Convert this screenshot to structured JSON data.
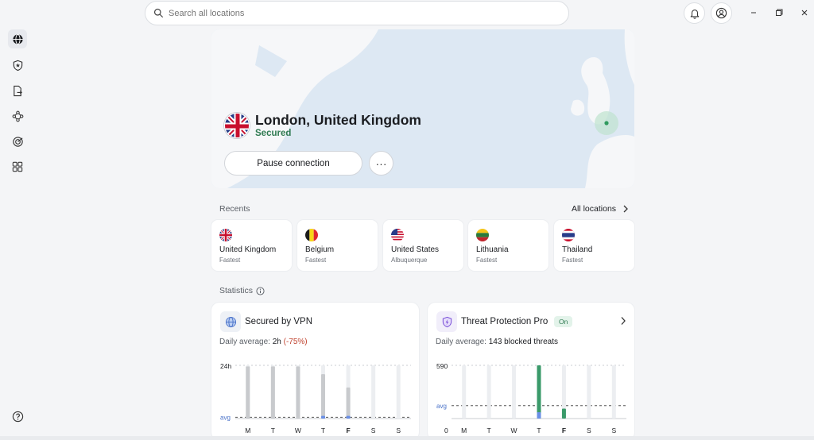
{
  "search": {
    "placeholder": "Search all locations"
  },
  "sidebar": {
    "items": [
      {
        "icon": "globe-icon",
        "active": true
      },
      {
        "icon": "shield-icon",
        "active": false
      },
      {
        "icon": "file-transfer-icon",
        "active": false
      },
      {
        "icon": "meshnet-icon",
        "active": false
      },
      {
        "icon": "target-icon",
        "active": false
      },
      {
        "icon": "apps-grid-icon",
        "active": false
      }
    ],
    "help_icon": "help-icon"
  },
  "connection": {
    "location": "London, United Kingdom",
    "status": "Secured",
    "pause_label": "Pause connection",
    "more_label": "···",
    "status_color": "#2f7a51"
  },
  "recents": {
    "label": "Recents",
    "all_label": "All locations",
    "items": [
      {
        "name": "United Kingdom",
        "sub": "Fastest",
        "flag": "uk"
      },
      {
        "name": "Belgium",
        "sub": "Fastest",
        "flag": "be"
      },
      {
        "name": "United States",
        "sub": "Albuquerque",
        "flag": "us"
      },
      {
        "name": "Lithuania",
        "sub": "Fastest",
        "flag": "lt"
      },
      {
        "name": "Thailand",
        "sub": "Fastest",
        "flag": "th"
      }
    ]
  },
  "statistics": {
    "label": "Statistics",
    "vpn": {
      "title": "Secured by VPN",
      "sub_label": "Daily average:",
      "sub_value": "2h",
      "sub_change": "(-75%)",
      "chart_data": {
        "type": "bar",
        "categories": [
          "M",
          "T",
          "W",
          "T",
          "F",
          "S",
          "S"
        ],
        "highlight_category": 4,
        "ytick_top": "24h",
        "avg_label": "avg",
        "ylim": [
          0,
          24
        ],
        "avg_value": 0.6,
        "series": [
          {
            "values": [
              24,
              24,
              24,
              24,
              24,
              24,
              24
            ],
            "color": "#eceef1"
          },
          {
            "values": [
              23.5,
              23.5,
              23.5,
              20,
              14,
              0,
              0
            ],
            "color": "#c8cacd"
          },
          {
            "values": [
              0,
              0,
              0,
              1.2,
              1.2,
              0,
              0
            ],
            "color": "#6a8fe6"
          }
        ]
      }
    },
    "threat": {
      "title": "Threat Protection Pro",
      "badge": "On",
      "sub_label": "Daily average:",
      "sub_value": "143 blocked threats",
      "chart_data": {
        "type": "bar",
        "categories": [
          "M",
          "T",
          "W",
          "T",
          "F",
          "S",
          "S"
        ],
        "highlight_category": 4,
        "ytick_top": "590",
        "ytick_bottom": "0",
        "avg_label": "avg",
        "ylim": [
          0,
          590
        ],
        "avg_value": 143,
        "series": [
          {
            "values": [
              590,
              590,
              590,
              590,
              590,
              590,
              590
            ],
            "color": "#eceef1"
          },
          {
            "values": [
              0,
              0,
              0,
              590,
              110,
              0,
              0
            ],
            "color": "#3a9a6a"
          },
          {
            "values": [
              0,
              0,
              0,
              70,
              0,
              0,
              0
            ],
            "color": "#6a8fe6"
          }
        ]
      }
    }
  },
  "colors": {
    "accent_green": "#2f7a51",
    "map_water": "#dde8f3",
    "map_land": "#f6f7f9"
  }
}
